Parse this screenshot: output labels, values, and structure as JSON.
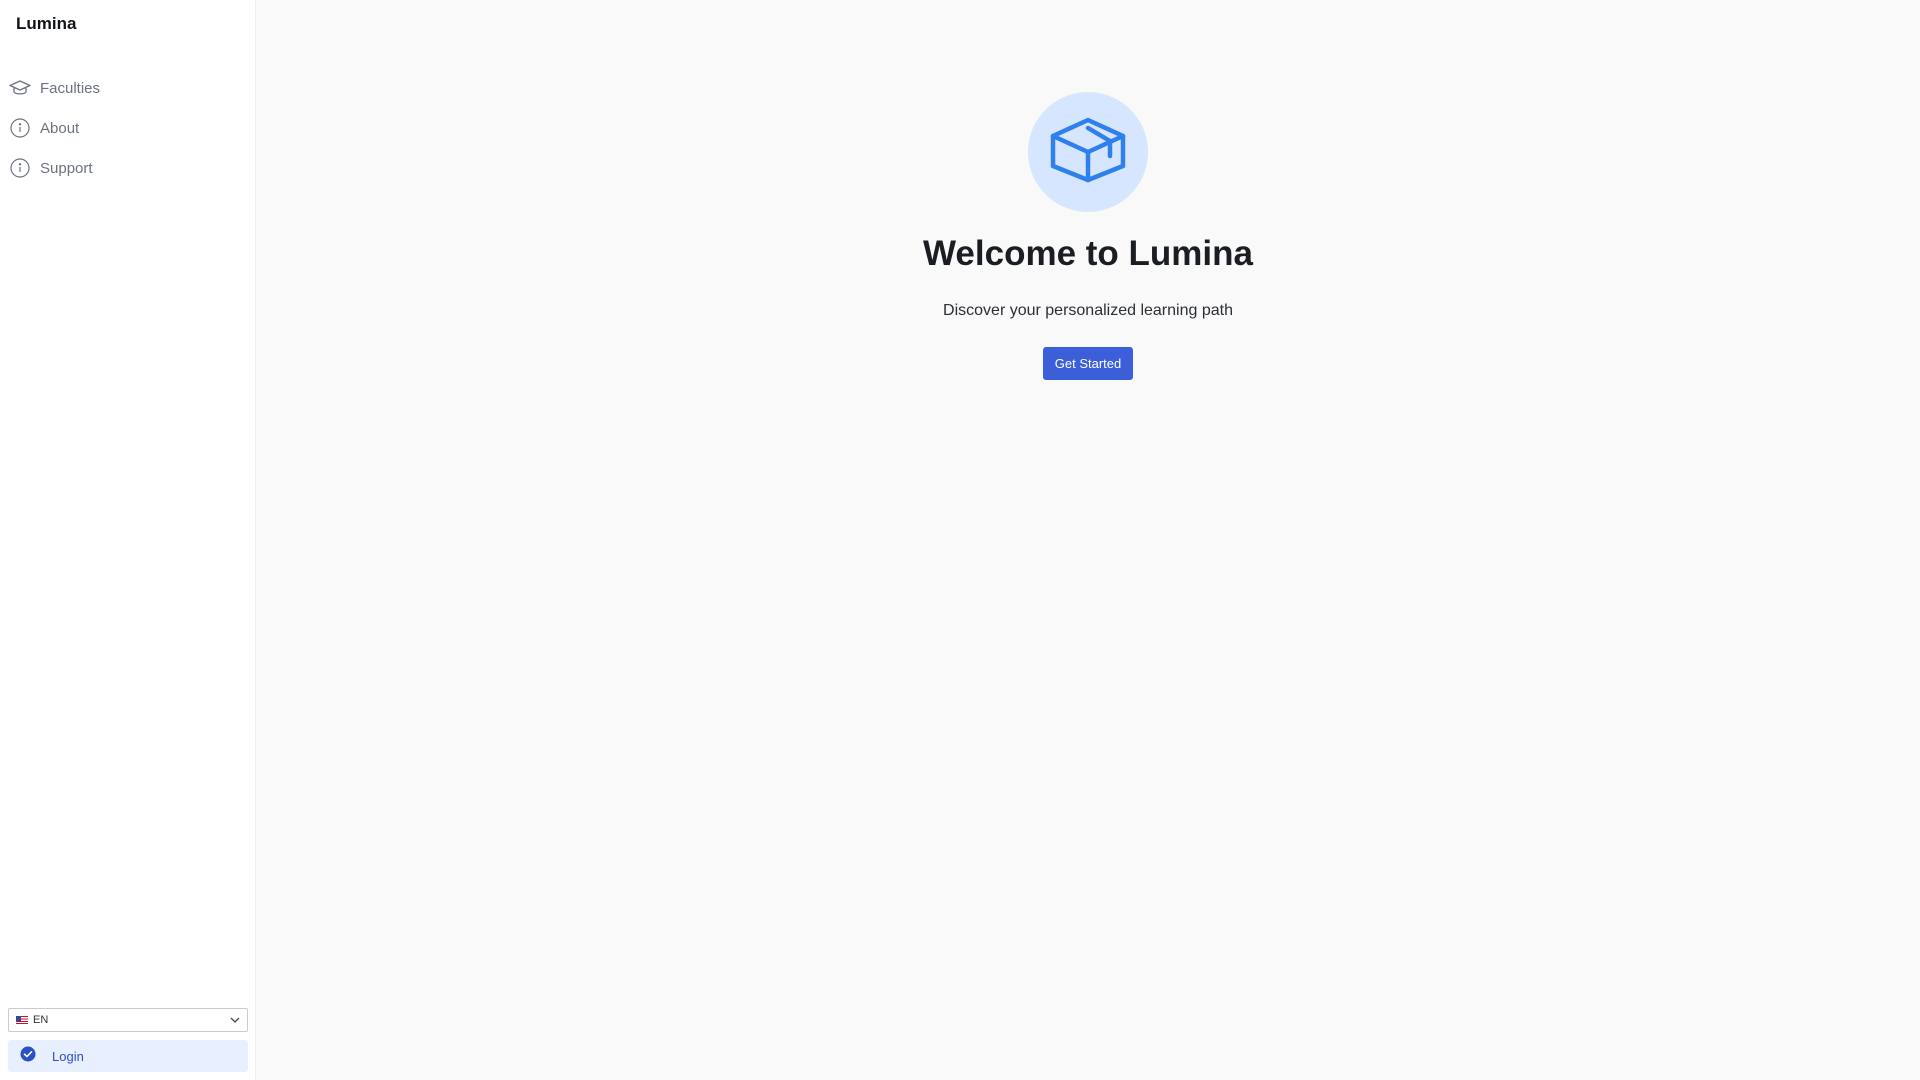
{
  "sidebar": {
    "brand": "Lumina",
    "items": [
      {
        "label": "Faculties",
        "icon": "graduation-cap-icon"
      },
      {
        "label": "About",
        "icon": "info-circle-icon"
      },
      {
        "label": "Support",
        "icon": "info-circle-icon"
      }
    ],
    "language": {
      "selected": "EN",
      "flag": "us-flag-icon"
    },
    "login_label": "Login"
  },
  "main": {
    "hero_icon": "graduation-cap-icon",
    "title": "Welcome to Lumina",
    "subtitle": "Discover your personalized learning path",
    "cta_label": "Get Started"
  },
  "colors": {
    "accent": "#3b5fd9",
    "hero_bg": "#d6e6ff",
    "hero_icon": "#2f80ed",
    "login_bg": "#e8efff",
    "nav_text": "#6b7280"
  }
}
